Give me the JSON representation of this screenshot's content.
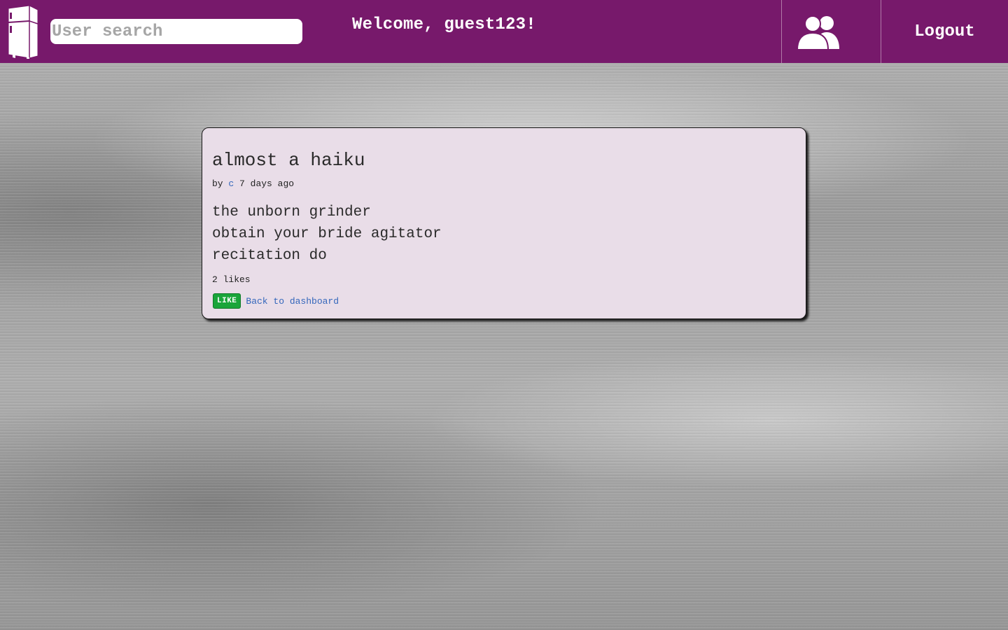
{
  "header": {
    "search_placeholder": "User search",
    "search_value": "",
    "welcome_text": "Welcome, guest123!",
    "logout_label": "Logout",
    "logo_icon": "fridge-icon",
    "users_icon": "users-icon",
    "bar_color": "#77196b"
  },
  "post": {
    "title": "almost a haiku",
    "by_label": "by",
    "author": "c",
    "posted_ago": "7 days ago",
    "lines": [
      "the unborn grinder",
      "obtain your bride agitator",
      "recitation do"
    ],
    "likes_text": "2 likes",
    "like_button_label": "LIKE",
    "back_link_label": "Back to dashboard",
    "card_color": "#e9dde8",
    "like_color": "#1aa53a",
    "link_color": "#3366bb"
  }
}
